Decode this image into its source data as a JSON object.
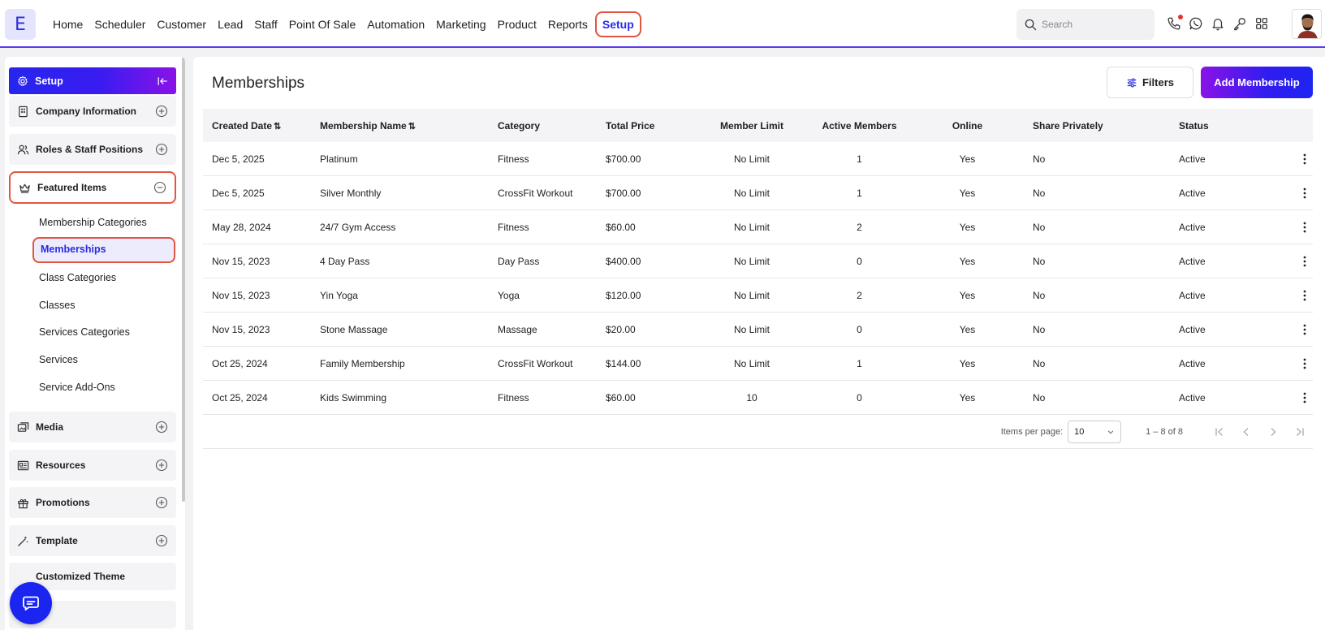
{
  "brand": {
    "logo_letter": "E"
  },
  "nav": {
    "items": [
      "Home",
      "Scheduler",
      "Customer",
      "Lead",
      "Staff",
      "Point Of Sale",
      "Automation",
      "Marketing",
      "Product",
      "Reports"
    ],
    "active": "Setup"
  },
  "search": {
    "placeholder": "Search",
    "value": ""
  },
  "top_icons": [
    "phone-icon",
    "whatsapp-icon",
    "bell-icon",
    "key-icon",
    "apps-grid-icon"
  ],
  "sidebar": {
    "header": "Setup",
    "sections": {
      "company": "Company Information",
      "roles": "Roles & Staff Positions",
      "featured": "Featured Items",
      "media": "Media",
      "resources": "Resources",
      "promotions": "Promotions",
      "template": "Template",
      "theme": "Customized Theme"
    },
    "featured_items": [
      "Membership Categories",
      "Memberships",
      "Class Categories",
      "Classes",
      "Services Categories",
      "Services",
      "Service Add-Ons"
    ]
  },
  "main": {
    "title": "Memberships",
    "filters_label": "Filters",
    "add_label": "Add Membership",
    "columns": [
      "Created Date",
      "Membership Name",
      "Category",
      "Total Price",
      "Member Limit",
      "Active Members",
      "Online",
      "Share Privately",
      "Status"
    ],
    "rows": [
      [
        "Dec 5, 2025",
        "Platinum",
        "Fitness",
        "$700.00",
        "No Limit",
        "1",
        "Yes",
        "No",
        "Active"
      ],
      [
        "Dec 5, 2025",
        "Silver Monthly",
        "CrossFit Workout",
        "$700.00",
        "No Limit",
        "1",
        "Yes",
        "No",
        "Active"
      ],
      [
        "May 28, 2024",
        "24/7 Gym Access",
        "Fitness",
        "$60.00",
        "No Limit",
        "2",
        "Yes",
        "No",
        "Active"
      ],
      [
        "Nov 15, 2023",
        "4 Day Pass",
        "Day Pass",
        "$400.00",
        "No Limit",
        "0",
        "Yes",
        "No",
        "Active"
      ],
      [
        "Nov 15, 2023",
        "Yin Yoga",
        "Yoga",
        "$120.00",
        "No Limit",
        "2",
        "Yes",
        "No",
        "Active"
      ],
      [
        "Nov 15, 2023",
        "Stone Massage",
        "Massage",
        "$20.00",
        "No Limit",
        "0",
        "Yes",
        "No",
        "Active"
      ],
      [
        "Oct 25, 2024",
        "Family Membership",
        "CrossFit Workout",
        "$144.00",
        "No Limit",
        "1",
        "Yes",
        "No",
        "Active"
      ],
      [
        "Oct 25, 2024",
        "Kids Swimming",
        "Fitness",
        "$60.00",
        "10",
        "0",
        "Yes",
        "No",
        "Active"
      ]
    ],
    "pagination": {
      "items_per_page_label": "Items per page:",
      "items_per_page": "10",
      "range": "1 – 8 of 8"
    }
  },
  "colors": {
    "accent": "#2a2ae6",
    "highlight_border": "#e25541",
    "gradient_start": "#2626ef",
    "gradient_end": "#8a12e8"
  }
}
